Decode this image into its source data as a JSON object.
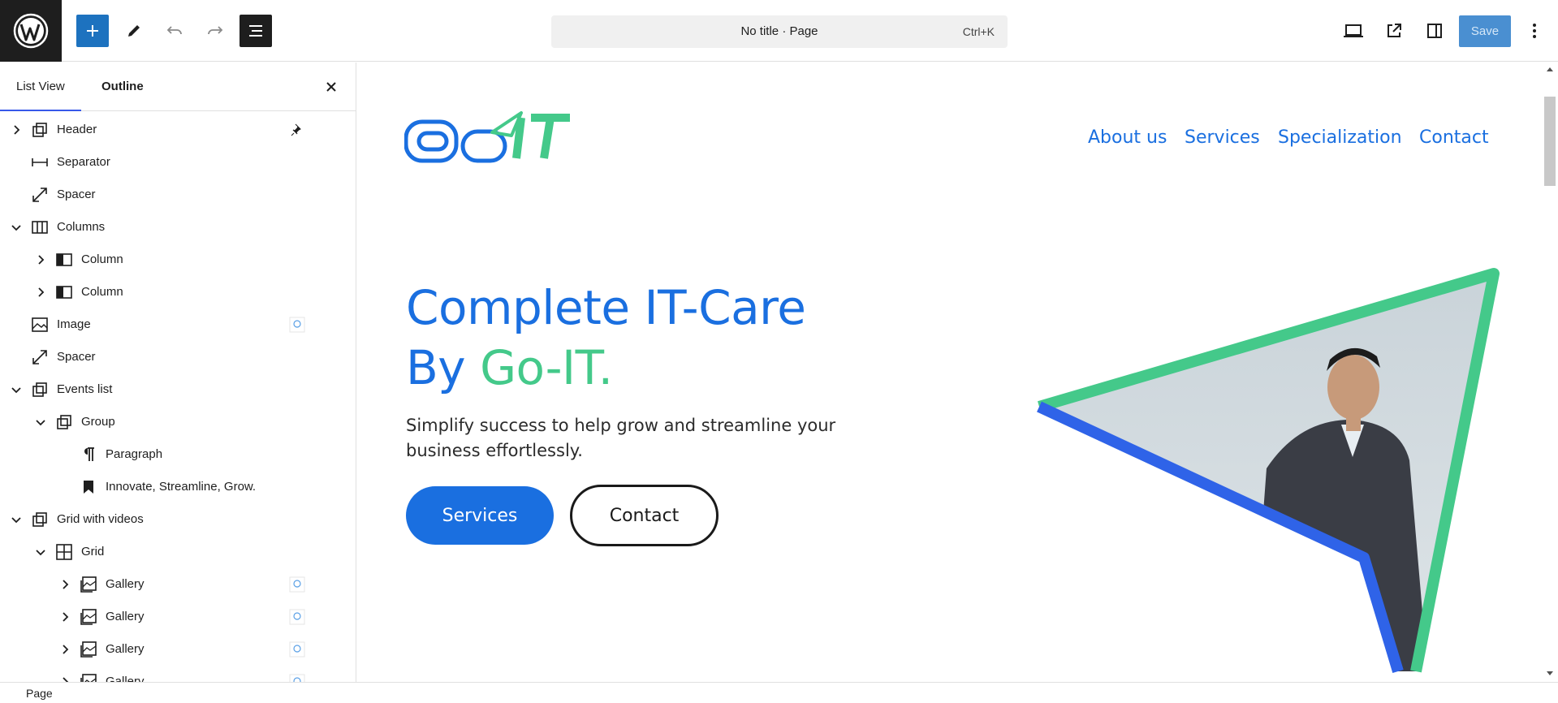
{
  "toolbar": {
    "document_title": "No title · Page",
    "shortcut": "Ctrl+K",
    "save_label": "Save"
  },
  "sidebar": {
    "tabs": [
      "List View",
      "Outline"
    ],
    "items": [
      {
        "label": "Header",
        "icon": "group-icon",
        "depth": 0,
        "expand": "collapsed",
        "aux": "pin-icon"
      },
      {
        "label": "Separator",
        "icon": "separator-icon",
        "depth": 0,
        "expand": "none"
      },
      {
        "label": "Spacer",
        "icon": "spacer-icon",
        "depth": 0,
        "expand": "none"
      },
      {
        "label": "Columns",
        "icon": "columns-icon",
        "depth": 0,
        "expand": "expanded"
      },
      {
        "label": "Column",
        "icon": "column-icon",
        "depth": 1,
        "expand": "collapsed"
      },
      {
        "label": "Column",
        "icon": "column-icon",
        "depth": 1,
        "expand": "collapsed"
      },
      {
        "label": "Image",
        "icon": "image-icon",
        "depth": 0,
        "expand": "none",
        "aux": "thumbnail"
      },
      {
        "label": "Spacer",
        "icon": "spacer-icon",
        "depth": 0,
        "expand": "none"
      },
      {
        "label": "Events list",
        "icon": "group-icon",
        "depth": 0,
        "expand": "expanded"
      },
      {
        "label": "Group",
        "icon": "group-icon",
        "depth": 1,
        "expand": "expanded"
      },
      {
        "label": "Paragraph",
        "icon": "paragraph-icon",
        "depth": 2,
        "expand": "none"
      },
      {
        "label": "Innovate, Streamline, Grow.",
        "icon": "bookmark-icon",
        "depth": 2,
        "expand": "none"
      },
      {
        "label": "Grid with videos",
        "icon": "group-icon",
        "depth": 0,
        "expand": "expanded"
      },
      {
        "label": "Grid",
        "icon": "grid-icon",
        "depth": 1,
        "expand": "expanded"
      },
      {
        "label": "Gallery",
        "icon": "gallery-icon",
        "depth": 2,
        "expand": "collapsed",
        "aux": "thumbnail"
      },
      {
        "label": "Gallery",
        "icon": "gallery-icon",
        "depth": 2,
        "expand": "collapsed",
        "aux": "thumbnail"
      },
      {
        "label": "Gallery",
        "icon": "gallery-icon",
        "depth": 2,
        "expand": "collapsed",
        "aux": "thumbnail"
      },
      {
        "label": "Gallery",
        "icon": "gallery-icon",
        "depth": 2,
        "expand": "collapsed",
        "aux": "thumbnail"
      }
    ]
  },
  "site": {
    "logo_text": "GoIT",
    "nav": [
      "About us",
      "Services",
      "Specialization",
      "Contact"
    ],
    "hero_line1": "Complete IT-Care",
    "hero_line2_a": "By ",
    "hero_line2_b": "Go-IT.",
    "hero_sub": "Simplify success to help grow and streamline your business effortlessly.",
    "btn_primary": "Services",
    "btn_secondary": "Contact"
  },
  "colors": {
    "brand_blue": "#1a6fe0",
    "brand_green": "#44c98a",
    "wp_dark": "#1e1e1e"
  },
  "statusbar": {
    "breadcrumb": "Page"
  }
}
